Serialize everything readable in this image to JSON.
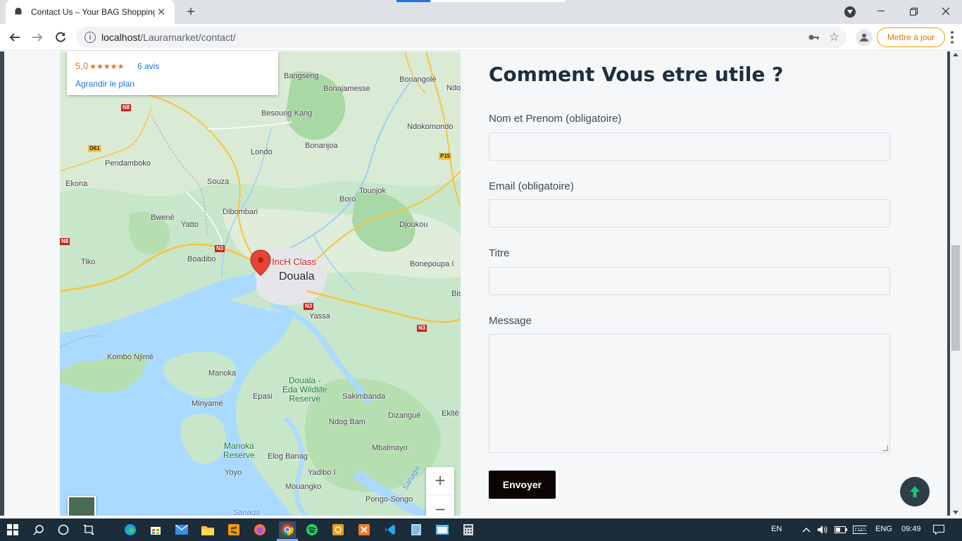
{
  "browser": {
    "tab_title": "Contact Us – Your BAG Shopping",
    "url_host": "localhost",
    "url_path": "/Lauramarket/contact/",
    "update_label": "Mettre à jour"
  },
  "map": {
    "rating": "5,0",
    "stars": "★★★★★",
    "reviews": "6 avis",
    "enlarge": "Agrandir le plan",
    "marker_label": "IncH Class",
    "labels": {
      "bangseng": "Bangseng",
      "bonangole": "Bonangolé",
      "ndo": "Ndo",
      "bonajamesse": "Bonajamesse",
      "besoung_kang": "Besoung Kang",
      "ndokomondo": "Ndokomondo",
      "bonanjoa": "Bonanjoa",
      "londo": "Londo",
      "pendamboko": "Pendamboko",
      "ekona": "Ekona",
      "souza": "Souza",
      "tounjok": "Tounjok",
      "boro": "Boro",
      "dibombari": "Dibombari",
      "bwene": "Bwené",
      "yatto": "Yatto",
      "djoukou": "Djoukou",
      "tiko": "Tiko",
      "boadibo": "Boadibo",
      "douala": "Douala",
      "bonepoupa": "Bonepoupa I",
      "bis": "Bis",
      "yassa": "Yassa",
      "kombo_njime": "Kombo Njimé",
      "manoka": "Manoka",
      "douala_edea": "Douala -\nEda Wildlife\nReserve",
      "epasi": "Epasi",
      "sakimbanda": "Sakimbanda",
      "minyame": "Minyamé",
      "dizangue": "Dizangué",
      "ekite": "Ekité",
      "ndog_bam": "Ndog Bam",
      "manoka_reserve": "Manoka\nReserve",
      "mbalmayo": "Mbalmayo",
      "elog_banag": "Elog Banag",
      "yoyo": "Yoyo",
      "yadibo": "Yadibo I",
      "mouangko": "Mouangko",
      "pongo_songo": "Pongo-Songo",
      "sanaga": "Sanaga",
      "sanaga2": "Sanaga"
    },
    "shields": {
      "n8_top": "N8",
      "d61": "D61",
      "p15": "P15",
      "n8_left": "N8",
      "n3_a": "N3",
      "n3_b": "N3",
      "n3_c": "N3"
    },
    "zoom_in": "+",
    "zoom_out": "−"
  },
  "form": {
    "title": "Comment Vous etre utile ?",
    "name_label": "Nom et Prenom (obligatoire)",
    "email_label": "Email (obligatoire)",
    "subject_label": "Titre",
    "message_label": "Message",
    "submit_label": "Envoyer"
  },
  "taskbar": {
    "lang_left": "EN",
    "lang_right": "ENG",
    "time": "09:49"
  },
  "colors": {
    "title": "#1e2e3d",
    "button": "#0b0403",
    "scroll_top": "#2d3e48",
    "accent": "#1a73e8",
    "update": "#e37400"
  }
}
